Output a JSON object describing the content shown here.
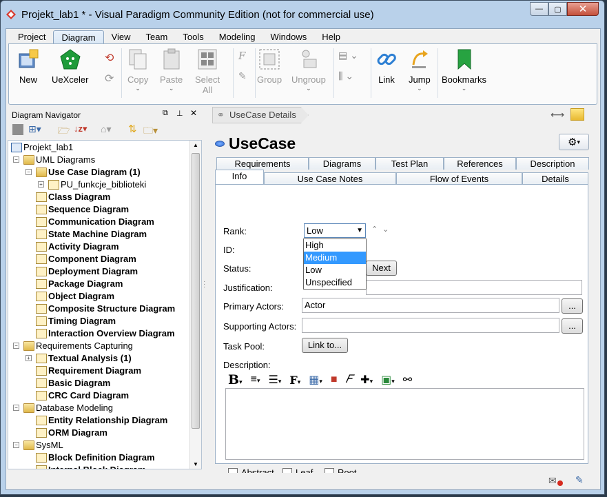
{
  "window": {
    "title": "Projekt_lab1 * - Visual Paradigm Community Edition (not for commercial use)",
    "close_label": "✕",
    "min_label": "—",
    "max_label": "▢"
  },
  "menu": [
    "Project",
    "Diagram",
    "View",
    "Team",
    "Tools",
    "Modeling",
    "Windows",
    "Help"
  ],
  "ribbon": {
    "new": "New",
    "uexceler": "UeXceler",
    "copy": "Copy",
    "paste": "Paste",
    "select_all_1": "Select",
    "select_all_2": "All",
    "group": "Group",
    "ungroup": "Ungroup",
    "link": "Link",
    "jump": "Jump",
    "bookmarks": "Bookmarks"
  },
  "navigator": {
    "title": "Diagram Navigator",
    "tree": [
      {
        "label": "Projekt_lab1",
        "level": 0,
        "icon": "project-icon",
        "bold": false
      },
      {
        "label": "UML Diagrams",
        "level": 1,
        "icon": "folder-icon",
        "bold": false,
        "pm": "-"
      },
      {
        "label": "Use Case Diagram (1)",
        "level": 2,
        "icon": "folder-icon",
        "bold": true,
        "pm": "-"
      },
      {
        "label": "PU_funkcje_biblioteki",
        "level": 3,
        "icon": "diagram-icon",
        "bold": false,
        "pm": "+"
      },
      {
        "label": "Class Diagram",
        "level": 2,
        "icon": "diagram-folder-icon",
        "bold": true
      },
      {
        "label": "Sequence Diagram",
        "level": 2,
        "icon": "diagram-folder-icon",
        "bold": true
      },
      {
        "label": "Communication Diagram",
        "level": 2,
        "icon": "diagram-folder-icon",
        "bold": true
      },
      {
        "label": "State Machine Diagram",
        "level": 2,
        "icon": "diagram-folder-icon",
        "bold": true
      },
      {
        "label": "Activity Diagram",
        "level": 2,
        "icon": "diagram-folder-icon",
        "bold": true
      },
      {
        "label": "Component Diagram",
        "level": 2,
        "icon": "diagram-folder-icon",
        "bold": true
      },
      {
        "label": "Deployment Diagram",
        "level": 2,
        "icon": "diagram-folder-icon",
        "bold": true
      },
      {
        "label": "Package Diagram",
        "level": 2,
        "icon": "diagram-folder-icon",
        "bold": true
      },
      {
        "label": "Object Diagram",
        "level": 2,
        "icon": "diagram-folder-icon",
        "bold": true
      },
      {
        "label": "Composite Structure Diagram",
        "level": 2,
        "icon": "diagram-folder-icon",
        "bold": true
      },
      {
        "label": "Timing Diagram",
        "level": 2,
        "icon": "diagram-folder-icon",
        "bold": true
      },
      {
        "label": "Interaction Overview Diagram",
        "level": 2,
        "icon": "diagram-folder-icon",
        "bold": true
      },
      {
        "label": "Requirements Capturing",
        "level": 1,
        "icon": "folder-icon",
        "bold": false,
        "pm": "-"
      },
      {
        "label": "Textual Analysis (1)",
        "level": 2,
        "icon": "diagram-folder-icon",
        "bold": true,
        "pm": "+"
      },
      {
        "label": "Requirement Diagram",
        "level": 2,
        "icon": "diagram-folder-icon",
        "bold": true
      },
      {
        "label": "Basic Diagram",
        "level": 2,
        "icon": "diagram-folder-icon",
        "bold": true
      },
      {
        "label": "CRC Card Diagram",
        "level": 2,
        "icon": "diagram-folder-icon",
        "bold": true
      },
      {
        "label": "Database Modeling",
        "level": 1,
        "icon": "folder-icon",
        "bold": false,
        "pm": "-"
      },
      {
        "label": "Entity Relationship Diagram",
        "level": 2,
        "icon": "diagram-folder-icon",
        "bold": true
      },
      {
        "label": "ORM Diagram",
        "level": 2,
        "icon": "diagram-folder-icon",
        "bold": true
      },
      {
        "label": "SysML",
        "level": 1,
        "icon": "folder-icon",
        "bold": false,
        "pm": "-"
      },
      {
        "label": "Block Definition Diagram",
        "level": 2,
        "icon": "diagram-folder-icon",
        "bold": true
      },
      {
        "label": "Internal Block Diagram",
        "level": 2,
        "icon": "diagram-folder-icon",
        "bold": true
      }
    ]
  },
  "details": {
    "breadcrumb": "UseCase Details",
    "title": "UseCase",
    "tabs_top": [
      "Requirements",
      "Diagrams",
      "Test Plan",
      "References",
      "Description"
    ],
    "tabs_bottom": [
      "Info",
      "Use Case Notes",
      "Flow of Events",
      "Details"
    ],
    "rank_label": "Rank:",
    "rank_value": "Low",
    "rank_options": [
      "High",
      "Medium",
      "Low",
      "Unspecified"
    ],
    "rank_highlighted": "Medium",
    "id_label": "ID:",
    "status_label": "Status:",
    "next_button": "Next",
    "justification_label": "Justification:",
    "primary_actors_label": "Primary Actors:",
    "primary_actors_value": "Actor",
    "supporting_actors_label": "Supporting Actors:",
    "ellipsis": "...",
    "task_pool_label": "Task Pool:",
    "link_to_button": "Link to...",
    "description_label": "Description:",
    "abstract_label": "Abstract",
    "leaf_label": "Leaf",
    "root_label": "Root"
  },
  "colors": {
    "accent": "#3399ff",
    "frame": "#b9d1ea"
  }
}
